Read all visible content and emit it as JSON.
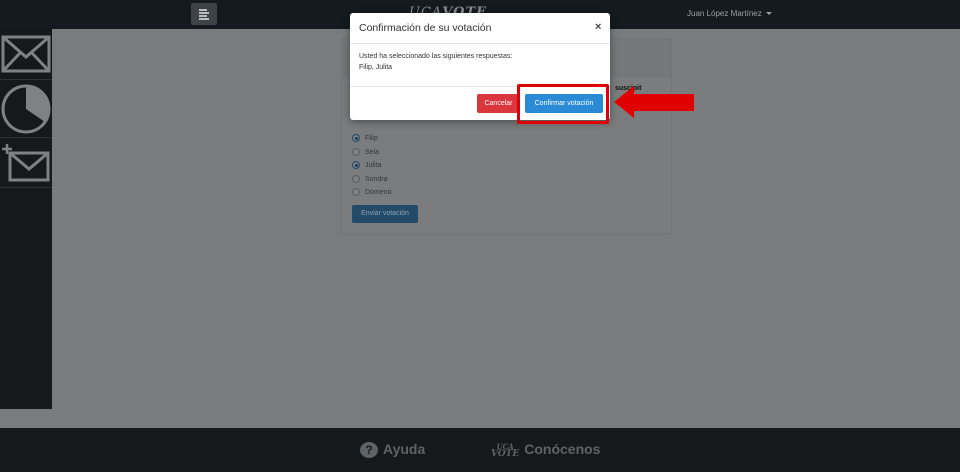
{
  "navbar": {
    "brand_prefix": "UCA",
    "brand_suffix": "VOTE",
    "user_name": "Juan López Martínez"
  },
  "sidebar": {
    "items": [
      {
        "icon": "envelope-icon"
      },
      {
        "icon": "pie-chart-icon"
      },
      {
        "icon": "new-envelope-icon"
      }
    ]
  },
  "poll": {
    "question_fragment": "suscipit",
    "options": [
      {
        "label": "Filip",
        "checked": true
      },
      {
        "label": "Sela",
        "checked": false
      },
      {
        "label": "Julita",
        "checked": true
      },
      {
        "label": "Sondra",
        "checked": false
      },
      {
        "label": "Domenic",
        "checked": false
      }
    ],
    "submit_label": "Enviar votación"
  },
  "modal": {
    "title": "Confirmación de su votación",
    "close_label": "×",
    "body_line1": "Usted ha seleccionado las siguientes respuestas:",
    "body_line2": "Filip, Julita",
    "cancel_label": "Cancelar",
    "confirm_label": "Confirmar votación"
  },
  "footer": {
    "help_label": "Ayuda",
    "about_logo_top": "UCA",
    "about_logo_bottom": "VOTE",
    "about_label": "Conócenos"
  },
  "colors": {
    "cancel": "#d9363e",
    "confirm": "#2a8ad6",
    "annotation": "#e00000"
  }
}
